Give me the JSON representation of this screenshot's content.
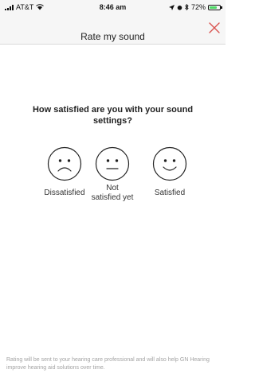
{
  "status_bar": {
    "carrier": "AT&T",
    "time": "8:46 am",
    "battery_percent": "72%",
    "battery_level": 0.72
  },
  "header": {
    "title": "Rate my sound",
    "close_icon": "close-icon",
    "close_color": "#d9534f"
  },
  "main": {
    "question": "How satisfied are you with your sound settings?",
    "options": [
      {
        "label": "Dissatisfied",
        "icon": "sad-face-icon"
      },
      {
        "label": "Not satisfied yet",
        "icon": "neutral-face-icon"
      },
      {
        "label": "Satisfied",
        "icon": "happy-face-icon"
      }
    ]
  },
  "footer": {
    "note": "Rating will be sent to your hearing care professional and will also help GN Hearing improve hearing aid solutions over time."
  }
}
